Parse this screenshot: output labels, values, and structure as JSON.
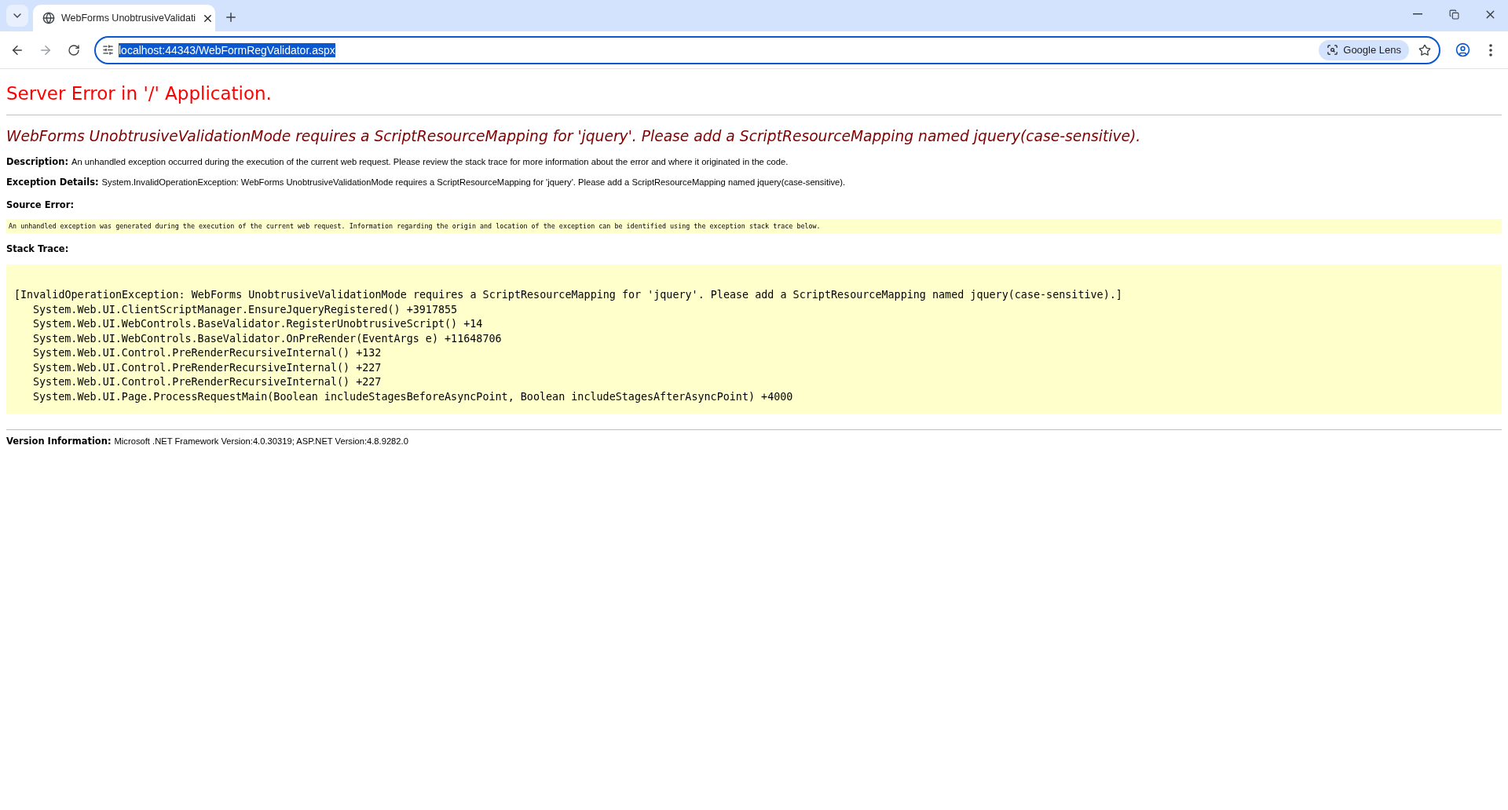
{
  "browser": {
    "tabs": [
      {
        "title": "WebForms UnobtrusiveValidati",
        "selected": true
      }
    ],
    "address": {
      "value": "localhost:44343/WebFormRegValidator.aspx",
      "selected": true
    },
    "lens_button": "Google Lens"
  },
  "page": {
    "title": "Server Error in '/' Application.",
    "heading": "WebForms UnobtrusiveValidationMode requires a ScriptResourceMapping for 'jquery'. Please add a ScriptResourceMapping named jquery(case-sensitive).",
    "description": {
      "label": "Description:",
      "text": "An unhandled exception occurred during the execution of the current web request. Please review the stack trace for more information about the error and where it originated in the code."
    },
    "exception_details": {
      "label": "Exception Details:",
      "text": "System.InvalidOperationException: WebForms UnobtrusiveValidationMode requires a ScriptResourceMapping for 'jquery'. Please add a ScriptResourceMapping named jquery(case-sensitive)."
    },
    "source_error": {
      "label": "Source Error:",
      "text": "An unhandled exception was generated during the execution of the current web request. Information regarding the origin and location of the exception can be identified using the exception stack trace below."
    },
    "stack_trace": {
      "label": "Stack Trace:",
      "header": "[InvalidOperationException: WebForms UnobtrusiveValidationMode requires a ScriptResourceMapping for 'jquery'. Please add a ScriptResourceMapping named jquery(case-sensitive).]",
      "frames": [
        "System.Web.UI.ClientScriptManager.EnsureJqueryRegistered() +3917855",
        "System.Web.UI.WebControls.BaseValidator.RegisterUnobtrusiveScript() +14",
        "System.Web.UI.WebControls.BaseValidator.OnPreRender(EventArgs e) +11648706",
        "System.Web.UI.Control.PreRenderRecursiveInternal() +132",
        "System.Web.UI.Control.PreRenderRecursiveInternal() +227",
        "System.Web.UI.Control.PreRenderRecursiveInternal() +227",
        "System.Web.UI.Page.ProcessRequestMain(Boolean includeStagesBeforeAsyncPoint, Boolean includeStagesAfterAsyncPoint) +4000"
      ]
    },
    "version_information": {
      "label": "Version Information:",
      "text": "Microsoft .NET Framework Version:4.0.30319; ASP.NET Version:4.8.9282.0"
    }
  }
}
